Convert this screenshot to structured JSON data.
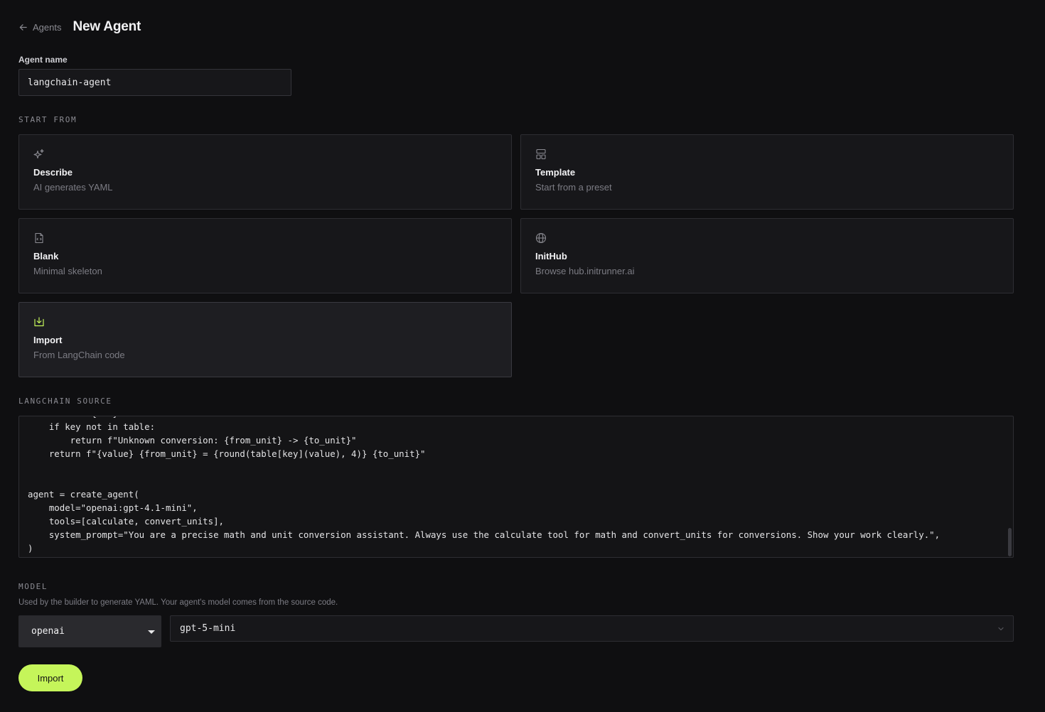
{
  "header": {
    "back_label": "Agents",
    "title": "New Agent"
  },
  "agent_name": {
    "label": "Agent name",
    "value": "langchain-agent"
  },
  "start_from": {
    "label": "START FROM",
    "options": [
      {
        "title": "Describe",
        "subtitle": "AI generates YAML",
        "icon": "sparkles-icon"
      },
      {
        "title": "Template",
        "subtitle": "Start from a preset",
        "icon": "template-icon"
      },
      {
        "title": "Blank",
        "subtitle": "Minimal skeleton",
        "icon": "file-code-icon"
      },
      {
        "title": "InitHub",
        "subtitle": "Browse hub.initrunner.ai",
        "icon": "globe-icon"
      },
      {
        "title": "Import",
        "subtitle": "From LangChain code",
        "icon": "import-icon",
        "selected": true
      }
    ]
  },
  "langchain_source": {
    "label": "LANGCHAIN SOURCE",
    "code": "    table = {...}\n    if key not in table:\n        return f\"Unknown conversion: {from_unit} -> {to_unit}\"\n    return f\"{value} {from_unit} = {round(table[key](value), 4)} {to_unit}\"\n\n\nagent = create_agent(\n    model=\"openai:gpt-4.1-mini\",\n    tools=[calculate, convert_units],\n    system_prompt=\"You are a precise math and unit conversion assistant. Always use the calculate tool for math and convert_units for conversions. Show your work clearly.\",\n)"
  },
  "model": {
    "label": "MODEL",
    "help": "Used by the builder to generate YAML. Your agent's model comes from the source code.",
    "provider": "openai",
    "model_name": "gpt-5-mini"
  },
  "actions": {
    "import_label": "Import"
  },
  "colors": {
    "accent": "#c5f55a",
    "background": "#0f0f11",
    "card": "#17171a"
  }
}
